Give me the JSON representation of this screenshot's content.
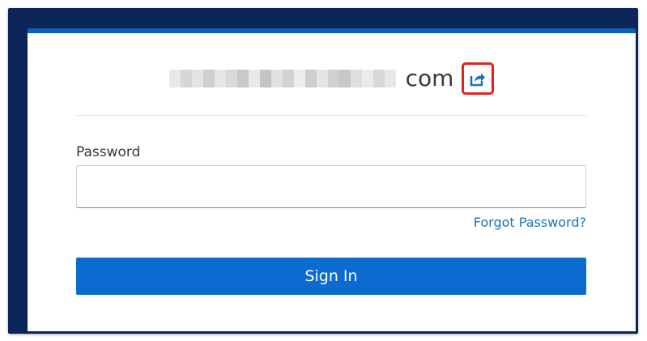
{
  "login": {
    "domain_suffix": "com",
    "password_label": "Password",
    "password_value": "",
    "password_placeholder": "",
    "forgot_password_label": "Forgot Password?",
    "sign_in_label": "Sign In"
  },
  "icons": {
    "share": "share-external-icon"
  },
  "colors": {
    "frame": "#0b2559",
    "accent_bar": "#0b5fb8",
    "primary_button": "#0b6bd0",
    "link": "#1a73b8",
    "highlight_border": "#e2231a"
  }
}
